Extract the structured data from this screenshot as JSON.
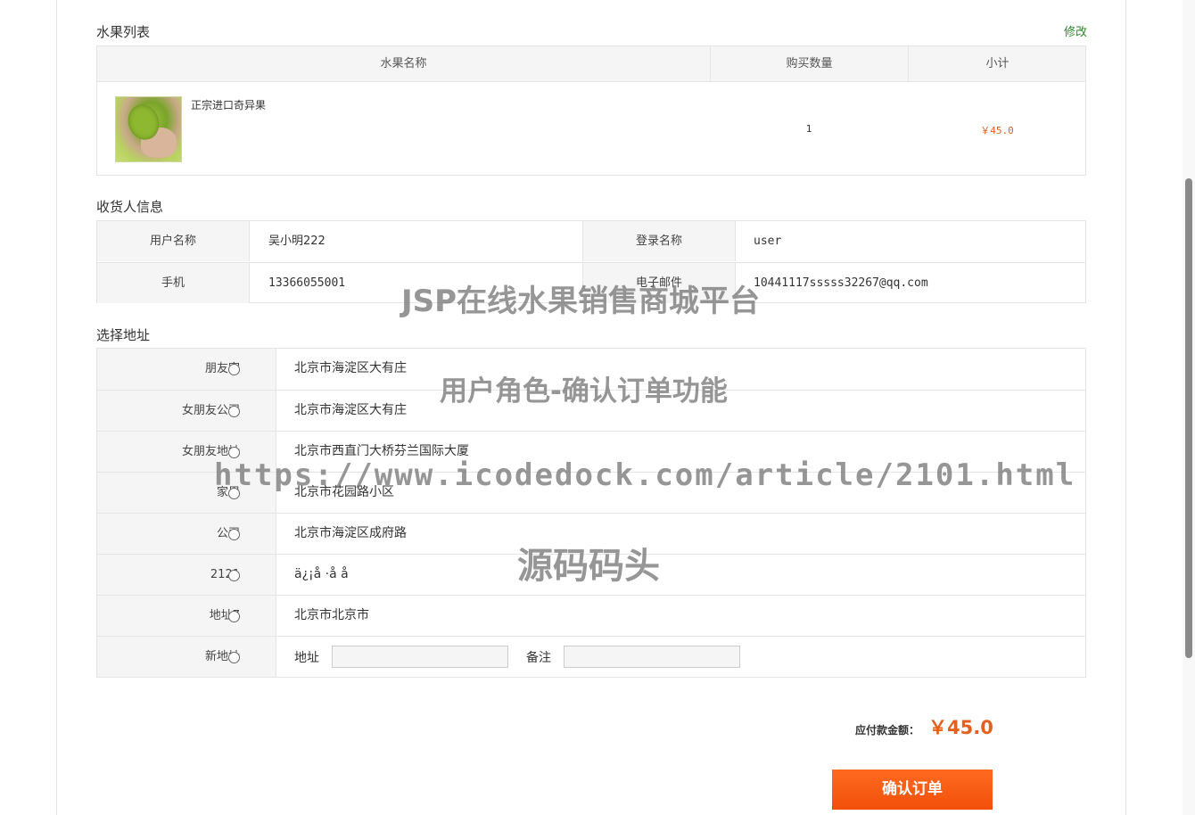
{
  "fruit_section": {
    "title": "水果列表",
    "edit_label": "修改",
    "headers": [
      "水果名称",
      "购买数量",
      "小计"
    ],
    "items": [
      {
        "name": "正宗进口奇异果",
        "quantity": "1",
        "subtotal": "￥45.0"
      }
    ]
  },
  "receiver_section": {
    "title": "收货人信息",
    "rows": [
      {
        "label1": "用户名称",
        "value1": "吴小明222",
        "label2": "登录名称",
        "value2": "user"
      },
      {
        "label1": "手机",
        "value1": "13366055001",
        "label2": "电子邮件",
        "value2": "10441117sssss32267@qq.com"
      }
    ]
  },
  "address_section": {
    "title": "选择地址",
    "addresses": [
      {
        "label": "朋友家",
        "address": "北京市海淀区大有庄"
      },
      {
        "label": "女朋友公司",
        "address": "北京市海淀区大有庄"
      },
      {
        "label": "女朋友地址",
        "address": "北京市西直门大桥芬兰国际大厦"
      },
      {
        "label": "家里",
        "address": "北京市花园路小区"
      },
      {
        "label": "公司",
        "address": "北京市海淀区成府路"
      },
      {
        "label": "2121",
        "address": "ä¿¡å  ·å   å"
      },
      {
        "label": "地址7",
        "address": "北京市北京市"
      }
    ],
    "new_address": {
      "label": "新地址",
      "address_label": "地址",
      "address_value": "",
      "note_label": "备注",
      "note_value": ""
    }
  },
  "summary": {
    "total_label": "应付款金额：",
    "total_amount": "￥45.0",
    "confirm_label": "确认订单"
  },
  "watermark": {
    "line1": "JSP在线水果销售商城平台",
    "line2": "用户角色-确认订单功能",
    "line3": "https://www.icodedock.com/article/2101.html",
    "line4": "源码码头"
  },
  "colors": {
    "accent": "#e4601c",
    "button": "#f2500a",
    "edit_link": "#2b8a2b",
    "header_bg": "#f5f5f5",
    "border": "#e5e5e5"
  }
}
